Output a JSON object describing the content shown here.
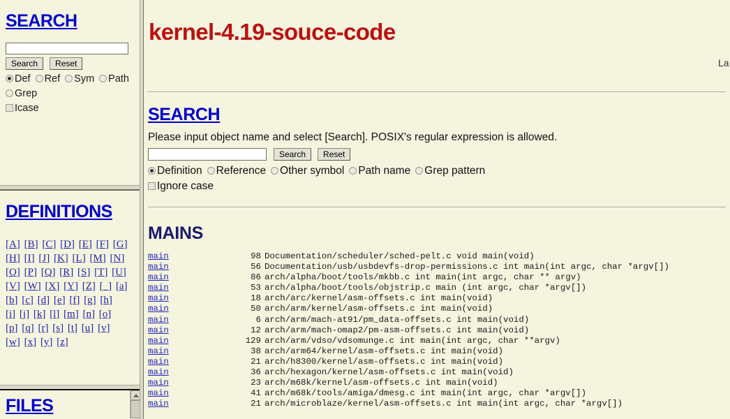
{
  "sidebar": {
    "search": {
      "heading": "SEARCH",
      "input_value": "",
      "input_placeholder": "",
      "search_button": "Search",
      "reset_button": "Reset",
      "options": [
        {
          "label": "Def",
          "checked": true
        },
        {
          "label": "Ref",
          "checked": false
        },
        {
          "label": "Sym",
          "checked": false
        },
        {
          "label": "Path",
          "checked": false
        },
        {
          "label": "Grep",
          "checked": false
        }
      ],
      "icase_label": "Icase",
      "icase_checked": false
    },
    "definitions": {
      "heading": "DEFINITIONS",
      "letters": [
        "A",
        "B",
        "C",
        "D",
        "E",
        "F",
        "G",
        "H",
        "I",
        "J",
        "K",
        "L",
        "M",
        "N",
        "O",
        "P",
        "Q",
        "R",
        "S",
        "T",
        "U",
        "V",
        "W",
        "X",
        "Y",
        "Z",
        "_",
        "a",
        "b",
        "c",
        "d",
        "e",
        "f",
        "g",
        "h",
        "i",
        "j",
        "k",
        "l",
        "m",
        "n",
        "o",
        "p",
        "q",
        "r",
        "s",
        "t",
        "u",
        "v",
        "w",
        "x",
        "y",
        "z"
      ]
    },
    "files": {
      "heading": "FILES"
    }
  },
  "main": {
    "project_title": "kernel-4.19-souce-code",
    "last_updated": "La",
    "search": {
      "heading": "SEARCH",
      "description": "Please input object name and select [Search]. POSIX's regular expression is allowed.",
      "input_value": "",
      "input_placeholder": "",
      "search_button": "Search",
      "reset_button": "Reset",
      "options": [
        {
          "label": "Definition",
          "checked": true
        },
        {
          "label": "Reference",
          "checked": false
        },
        {
          "label": "Other symbol",
          "checked": false
        },
        {
          "label": "Path name",
          "checked": false
        },
        {
          "label": "Grep pattern",
          "checked": false
        }
      ],
      "ignore_case_label": "Ignore case",
      "ignore_case_checked": false
    },
    "mains": {
      "heading": "MAINS",
      "rows": [
        {
          "tag": "main",
          "lineno": "98",
          "text": "Documentation/scheduler/sched-pelt.c void main(void)"
        },
        {
          "tag": "main",
          "lineno": "56",
          "text": "Documentation/usb/usbdevfs-drop-permissions.c int main(int argc, char *argv[])"
        },
        {
          "tag": "main",
          "lineno": "86",
          "text": "arch/alpha/boot/tools/mkbb.c int main(int argc, char ** argv)"
        },
        {
          "tag": "main",
          "lineno": "53",
          "text": "arch/alpha/boot/tools/objstrip.c main (int argc, char *argv[])"
        },
        {
          "tag": "main",
          "lineno": "18",
          "text": "arch/arc/kernel/asm-offsets.c int main(void)"
        },
        {
          "tag": "main",
          "lineno": "50",
          "text": "arch/arm/kernel/asm-offsets.c int main(void)"
        },
        {
          "tag": "main",
          "lineno": "6",
          "text": "arch/arm/mach-at91/pm_data-offsets.c int main(void)"
        },
        {
          "tag": "main",
          "lineno": "12",
          "text": "arch/arm/mach-omap2/pm-asm-offsets.c int main(void)"
        },
        {
          "tag": "main",
          "lineno": "129",
          "text": "arch/arm/vdso/vdsomunge.c int main(int argc, char **argv)"
        },
        {
          "tag": "main",
          "lineno": "38",
          "text": "arch/arm64/kernel/asm-offsets.c int main(void)"
        },
        {
          "tag": "main",
          "lineno": "21",
          "text": "arch/h8300/kernel/asm-offsets.c int main(void)"
        },
        {
          "tag": "main",
          "lineno": "36",
          "text": "arch/hexagon/kernel/asm-offsets.c int main(void)"
        },
        {
          "tag": "main",
          "lineno": "23",
          "text": "arch/m68k/kernel/asm-offsets.c int main(void)"
        },
        {
          "tag": "main",
          "lineno": "41",
          "text": "arch/m68k/tools/amiga/dmesg.c int main(int argc, char *argv[])"
        },
        {
          "tag": "main",
          "lineno": "21",
          "text": "arch/microblaze/kernel/asm-offsets.c int main(int argc, char *argv[])"
        }
      ]
    }
  },
  "colors": {
    "background": "#f4f4df",
    "link_blue": "#0000cc",
    "title_red": "#bb1111",
    "heading_navy": "#1a1a6e",
    "tag_blue": "#2222bb"
  }
}
